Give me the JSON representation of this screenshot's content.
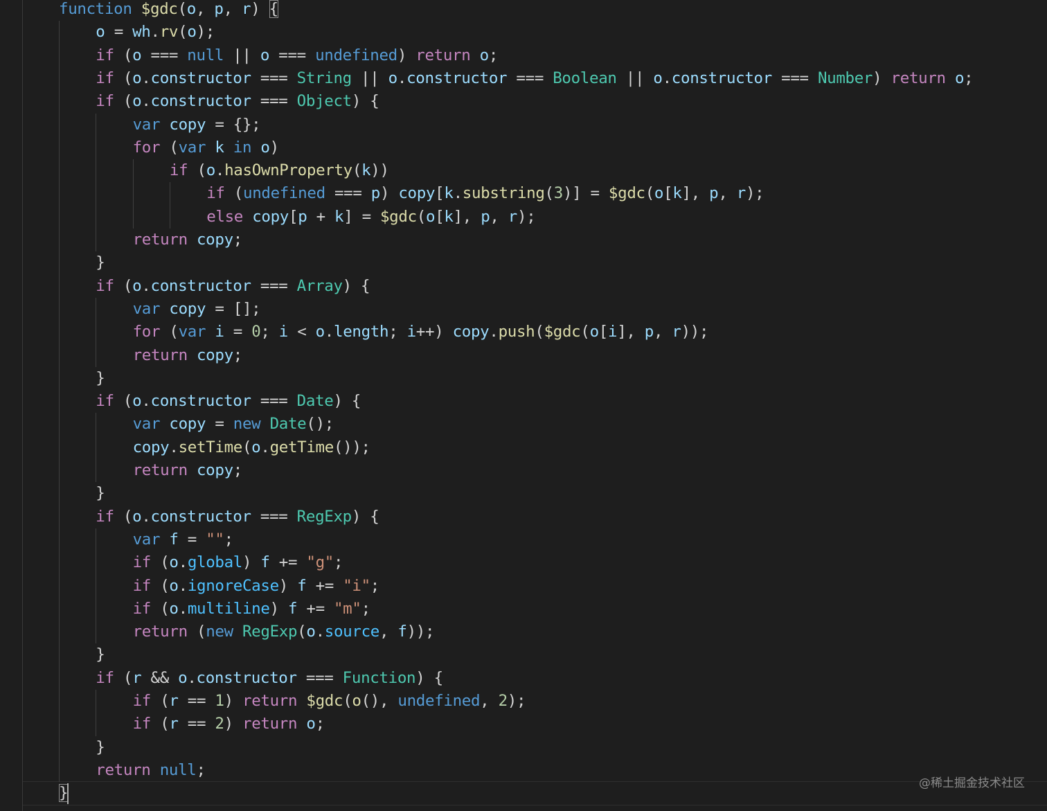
{
  "colors": {
    "background": "#1e1e1e",
    "keyword": "#569cd6",
    "control": "#c586c0",
    "function": "#dcdcaa",
    "variable": "#9cdcfe",
    "type": "#4ec9b0",
    "string": "#ce9178",
    "number": "#b5cea8",
    "property": "#4fc1ff",
    "punctuation": "#d4d4d4"
  },
  "watermark": "@稀土掘金技术社区",
  "code_lines": [
    [
      [
        "kw",
        "function"
      ],
      [
        "p",
        " "
      ],
      [
        "fn",
        "$gdc"
      ],
      [
        "p",
        "("
      ],
      [
        "var",
        "o"
      ],
      [
        "p",
        ", "
      ],
      [
        "var",
        "p"
      ],
      [
        "p",
        ", "
      ],
      [
        "var",
        "r"
      ],
      [
        "p",
        ") "
      ],
      [
        "bm",
        "{"
      ]
    ],
    [
      [
        "var",
        "o"
      ],
      [
        "p",
        " = "
      ],
      [
        "var",
        "wh"
      ],
      [
        "p",
        "."
      ],
      [
        "fn",
        "rv"
      ],
      [
        "p",
        "("
      ],
      [
        "var",
        "o"
      ],
      [
        "p",
        ");"
      ]
    ],
    [
      [
        "ctl",
        "if"
      ],
      [
        "p",
        " ("
      ],
      [
        "var",
        "o"
      ],
      [
        "p",
        " === "
      ],
      [
        "kw",
        "null"
      ],
      [
        "p",
        " || "
      ],
      [
        "var",
        "o"
      ],
      [
        "p",
        " === "
      ],
      [
        "kw",
        "undefined"
      ],
      [
        "p",
        ") "
      ],
      [
        "ctl",
        "return"
      ],
      [
        "p",
        " "
      ],
      [
        "var",
        "o"
      ],
      [
        "p",
        ";"
      ]
    ],
    [
      [
        "ctl",
        "if"
      ],
      [
        "p",
        " ("
      ],
      [
        "var",
        "o"
      ],
      [
        "p",
        "."
      ],
      [
        "var",
        "constructor"
      ],
      [
        "p",
        " === "
      ],
      [
        "type",
        "String"
      ],
      [
        "p",
        " || "
      ],
      [
        "var",
        "o"
      ],
      [
        "p",
        "."
      ],
      [
        "var",
        "constructor"
      ],
      [
        "p",
        " === "
      ],
      [
        "type",
        "Boolean"
      ],
      [
        "p",
        " || "
      ],
      [
        "var",
        "o"
      ],
      [
        "p",
        "."
      ],
      [
        "var",
        "constructor"
      ],
      [
        "p",
        " === "
      ],
      [
        "type",
        "Number"
      ],
      [
        "p",
        ") "
      ],
      [
        "ctl",
        "return"
      ],
      [
        "p",
        " "
      ],
      [
        "var",
        "o"
      ],
      [
        "p",
        ";"
      ]
    ],
    [
      [
        "ctl",
        "if"
      ],
      [
        "p",
        " ("
      ],
      [
        "var",
        "o"
      ],
      [
        "p",
        "."
      ],
      [
        "var",
        "constructor"
      ],
      [
        "p",
        " === "
      ],
      [
        "type",
        "Object"
      ],
      [
        "p",
        ") {"
      ]
    ],
    [
      [
        "kw",
        "var"
      ],
      [
        "p",
        " "
      ],
      [
        "var",
        "copy"
      ],
      [
        "p",
        " = {};"
      ]
    ],
    [
      [
        "ctl",
        "for"
      ],
      [
        "p",
        " ("
      ],
      [
        "kw",
        "var"
      ],
      [
        "p",
        " "
      ],
      [
        "var",
        "k"
      ],
      [
        "p",
        " "
      ],
      [
        "kw",
        "in"
      ],
      [
        "p",
        " "
      ],
      [
        "var",
        "o"
      ],
      [
        "p",
        ")"
      ]
    ],
    [
      [
        "ctl",
        "if"
      ],
      [
        "p",
        " ("
      ],
      [
        "var",
        "o"
      ],
      [
        "p",
        "."
      ],
      [
        "fn",
        "hasOwnProperty"
      ],
      [
        "p",
        "("
      ],
      [
        "var",
        "k"
      ],
      [
        "p",
        "))"
      ]
    ],
    [
      [
        "ctl",
        "if"
      ],
      [
        "p",
        " ("
      ],
      [
        "kw",
        "undefined"
      ],
      [
        "p",
        " === "
      ],
      [
        "var",
        "p"
      ],
      [
        "p",
        ") "
      ],
      [
        "var",
        "copy"
      ],
      [
        "p",
        "["
      ],
      [
        "var",
        "k"
      ],
      [
        "p",
        "."
      ],
      [
        "fn",
        "substring"
      ],
      [
        "p",
        "("
      ],
      [
        "num",
        "3"
      ],
      [
        "p",
        ")] = "
      ],
      [
        "fn",
        "$gdc"
      ],
      [
        "p",
        "("
      ],
      [
        "var",
        "o"
      ],
      [
        "p",
        "["
      ],
      [
        "var",
        "k"
      ],
      [
        "p",
        "], "
      ],
      [
        "var",
        "p"
      ],
      [
        "p",
        ", "
      ],
      [
        "var",
        "r"
      ],
      [
        "p",
        ");"
      ]
    ],
    [
      [
        "ctl",
        "else"
      ],
      [
        "p",
        " "
      ],
      [
        "var",
        "copy"
      ],
      [
        "p",
        "["
      ],
      [
        "var",
        "p"
      ],
      [
        "p",
        " + "
      ],
      [
        "var",
        "k"
      ],
      [
        "p",
        "] = "
      ],
      [
        "fn",
        "$gdc"
      ],
      [
        "p",
        "("
      ],
      [
        "var",
        "o"
      ],
      [
        "p",
        "["
      ],
      [
        "var",
        "k"
      ],
      [
        "p",
        "], "
      ],
      [
        "var",
        "p"
      ],
      [
        "p",
        ", "
      ],
      [
        "var",
        "r"
      ],
      [
        "p",
        ");"
      ]
    ],
    [
      [
        "ctl",
        "return"
      ],
      [
        "p",
        " "
      ],
      [
        "var",
        "copy"
      ],
      [
        "p",
        ";"
      ]
    ],
    [
      [
        "p",
        "}"
      ]
    ],
    [
      [
        "ctl",
        "if"
      ],
      [
        "p",
        " ("
      ],
      [
        "var",
        "o"
      ],
      [
        "p",
        "."
      ],
      [
        "var",
        "constructor"
      ],
      [
        "p",
        " === "
      ],
      [
        "type",
        "Array"
      ],
      [
        "p",
        ") {"
      ]
    ],
    [
      [
        "kw",
        "var"
      ],
      [
        "p",
        " "
      ],
      [
        "var",
        "copy"
      ],
      [
        "p",
        " = [];"
      ]
    ],
    [
      [
        "ctl",
        "for"
      ],
      [
        "p",
        " ("
      ],
      [
        "kw",
        "var"
      ],
      [
        "p",
        " "
      ],
      [
        "var",
        "i"
      ],
      [
        "p",
        " = "
      ],
      [
        "num",
        "0"
      ],
      [
        "p",
        "; "
      ],
      [
        "var",
        "i"
      ],
      [
        "p",
        " < "
      ],
      [
        "var",
        "o"
      ],
      [
        "p",
        "."
      ],
      [
        "var",
        "length"
      ],
      [
        "p",
        "; "
      ],
      [
        "var",
        "i"
      ],
      [
        "p",
        "++) "
      ],
      [
        "var",
        "copy"
      ],
      [
        "p",
        "."
      ],
      [
        "fn",
        "push"
      ],
      [
        "p",
        "("
      ],
      [
        "fn",
        "$gdc"
      ],
      [
        "p",
        "("
      ],
      [
        "var",
        "o"
      ],
      [
        "p",
        "["
      ],
      [
        "var",
        "i"
      ],
      [
        "p",
        "], "
      ],
      [
        "var",
        "p"
      ],
      [
        "p",
        ", "
      ],
      [
        "var",
        "r"
      ],
      [
        "p",
        "));"
      ]
    ],
    [
      [
        "ctl",
        "return"
      ],
      [
        "p",
        " "
      ],
      [
        "var",
        "copy"
      ],
      [
        "p",
        ";"
      ]
    ],
    [
      [
        "p",
        "}"
      ]
    ],
    [
      [
        "ctl",
        "if"
      ],
      [
        "p",
        " ("
      ],
      [
        "var",
        "o"
      ],
      [
        "p",
        "."
      ],
      [
        "var",
        "constructor"
      ],
      [
        "p",
        " === "
      ],
      [
        "type",
        "Date"
      ],
      [
        "p",
        ") {"
      ]
    ],
    [
      [
        "kw",
        "var"
      ],
      [
        "p",
        " "
      ],
      [
        "var",
        "copy"
      ],
      [
        "p",
        " = "
      ],
      [
        "kw",
        "new"
      ],
      [
        "p",
        " "
      ],
      [
        "type",
        "Date"
      ],
      [
        "p",
        "();"
      ]
    ],
    [
      [
        "var",
        "copy"
      ],
      [
        "p",
        "."
      ],
      [
        "fn",
        "setTime"
      ],
      [
        "p",
        "("
      ],
      [
        "var",
        "o"
      ],
      [
        "p",
        "."
      ],
      [
        "fn",
        "getTime"
      ],
      [
        "p",
        "());"
      ]
    ],
    [
      [
        "ctl",
        "return"
      ],
      [
        "p",
        " "
      ],
      [
        "var",
        "copy"
      ],
      [
        "p",
        ";"
      ]
    ],
    [
      [
        "p",
        "}"
      ]
    ],
    [
      [
        "ctl",
        "if"
      ],
      [
        "p",
        " ("
      ],
      [
        "var",
        "o"
      ],
      [
        "p",
        "."
      ],
      [
        "var",
        "constructor"
      ],
      [
        "p",
        " === "
      ],
      [
        "type",
        "RegExp"
      ],
      [
        "p",
        ") {"
      ]
    ],
    [
      [
        "kw",
        "var"
      ],
      [
        "p",
        " "
      ],
      [
        "var",
        "f"
      ],
      [
        "p",
        " = "
      ],
      [
        "str",
        "\"\""
      ],
      [
        "p",
        ";"
      ]
    ],
    [
      [
        "ctl",
        "if"
      ],
      [
        "p",
        " ("
      ],
      [
        "var",
        "o"
      ],
      [
        "p",
        "."
      ],
      [
        "prop",
        "global"
      ],
      [
        "p",
        ") "
      ],
      [
        "var",
        "f"
      ],
      [
        "p",
        " += "
      ],
      [
        "str",
        "\"g\""
      ],
      [
        "p",
        ";"
      ]
    ],
    [
      [
        "ctl",
        "if"
      ],
      [
        "p",
        " ("
      ],
      [
        "var",
        "o"
      ],
      [
        "p",
        "."
      ],
      [
        "prop",
        "ignoreCase"
      ],
      [
        "p",
        ") "
      ],
      [
        "var",
        "f"
      ],
      [
        "p",
        " += "
      ],
      [
        "str",
        "\"i\""
      ],
      [
        "p",
        ";"
      ]
    ],
    [
      [
        "ctl",
        "if"
      ],
      [
        "p",
        " ("
      ],
      [
        "var",
        "o"
      ],
      [
        "p",
        "."
      ],
      [
        "prop",
        "multiline"
      ],
      [
        "p",
        ") "
      ],
      [
        "var",
        "f"
      ],
      [
        "p",
        " += "
      ],
      [
        "str",
        "\"m\""
      ],
      [
        "p",
        ";"
      ]
    ],
    [
      [
        "ctl",
        "return"
      ],
      [
        "p",
        " ("
      ],
      [
        "kw",
        "new"
      ],
      [
        "p",
        " "
      ],
      [
        "type",
        "RegExp"
      ],
      [
        "p",
        "("
      ],
      [
        "var",
        "o"
      ],
      [
        "p",
        "."
      ],
      [
        "prop",
        "source"
      ],
      [
        "p",
        ", "
      ],
      [
        "var",
        "f"
      ],
      [
        "p",
        "));"
      ]
    ],
    [
      [
        "p",
        "}"
      ]
    ],
    [
      [
        "ctl",
        "if"
      ],
      [
        "p",
        " ("
      ],
      [
        "var",
        "r"
      ],
      [
        "p",
        " && "
      ],
      [
        "var",
        "o"
      ],
      [
        "p",
        "."
      ],
      [
        "var",
        "constructor"
      ],
      [
        "p",
        " === "
      ],
      [
        "type",
        "Function"
      ],
      [
        "p",
        ") {"
      ]
    ],
    [
      [
        "ctl",
        "if"
      ],
      [
        "p",
        " ("
      ],
      [
        "var",
        "r"
      ],
      [
        "p",
        " == "
      ],
      [
        "num",
        "1"
      ],
      [
        "p",
        ") "
      ],
      [
        "ctl",
        "return"
      ],
      [
        "p",
        " "
      ],
      [
        "fn",
        "$gdc"
      ],
      [
        "p",
        "("
      ],
      [
        "fn",
        "o"
      ],
      [
        "p",
        "(), "
      ],
      [
        "kw",
        "undefined"
      ],
      [
        "p",
        ", "
      ],
      [
        "num",
        "2"
      ],
      [
        "p",
        ");"
      ]
    ],
    [
      [
        "ctl",
        "if"
      ],
      [
        "p",
        " ("
      ],
      [
        "var",
        "r"
      ],
      [
        "p",
        " == "
      ],
      [
        "num",
        "2"
      ],
      [
        "p",
        ") "
      ],
      [
        "ctl",
        "return"
      ],
      [
        "p",
        " "
      ],
      [
        "var",
        "o"
      ],
      [
        "p",
        ";"
      ]
    ],
    [
      [
        "p",
        "}"
      ]
    ],
    [
      [
        "ctl",
        "return"
      ],
      [
        "p",
        " "
      ],
      [
        "kw",
        "null"
      ],
      [
        "p",
        ";"
      ]
    ],
    [
      [
        "bm",
        "}"
      ]
    ]
  ]
}
